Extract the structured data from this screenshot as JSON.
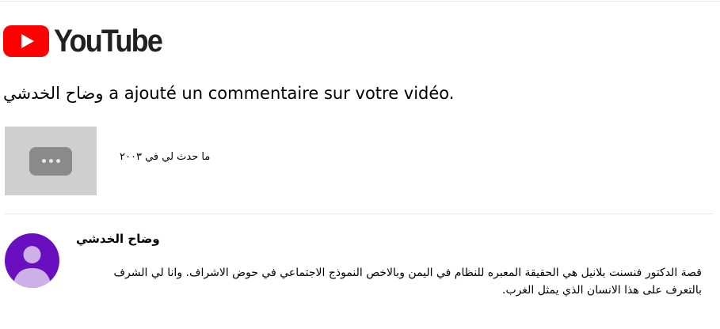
{
  "brand": {
    "name": "YouTube",
    "logo_icon": "youtube-play-icon",
    "logo_color": "#ff0000",
    "text_color": "#212121"
  },
  "headline": {
    "author": "وضاح الخدشي",
    "action": " a ajouté un commentaire sur votre vidéo."
  },
  "video": {
    "thumbnail_icon": "more-dots-icon",
    "title": "ما حدث لي في ٢٠٠٣"
  },
  "comment": {
    "avatar_icon": "default-user-avatar-icon",
    "avatar_color": "#6a0fbf",
    "author": "وضاح الخدشي",
    "text": "قصة الدكتور فنسنت بلانيل هي الحقيقة المعبره للنظام في اليمن وبالاخص النموذج الاجتماعي في حوض الاشراف. وانا لي الشرف بالتعرف على هذا الانسان الذي يمثل الغرب."
  }
}
